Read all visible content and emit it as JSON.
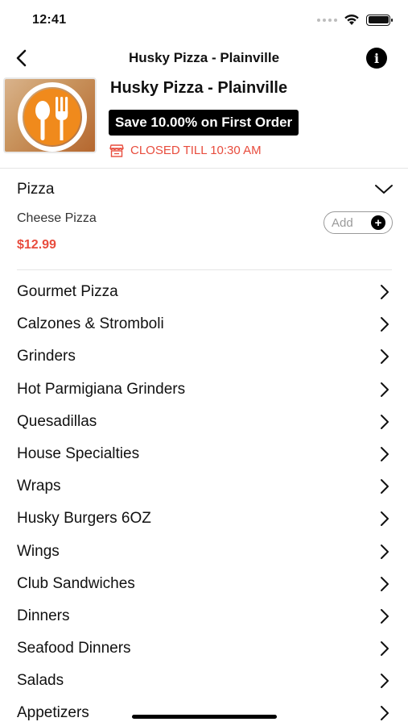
{
  "status_bar": {
    "time": "12:41"
  },
  "nav": {
    "title": "Husky Pizza - Plainville",
    "info_glyph": "i"
  },
  "restaurant": {
    "name": "Husky Pizza - Plainville",
    "promo": "Save 10.00% on First Order",
    "status": "CLOSED TILL 10:30 AM",
    "status_color": "#e84c3d"
  },
  "expanded_section": {
    "title": "Pizza",
    "items": [
      {
        "name": "Cheese Pizza",
        "price": "$12.99",
        "add_label": "Add",
        "add_glyph": "+"
      }
    ]
  },
  "categories": [
    "Gourmet Pizza",
    "Calzones & Stromboli",
    "Grinders",
    "Hot Parmigiana Grinders",
    "Quesadillas",
    "House Specialties",
    "Wraps",
    "Husky Burgers 6OZ",
    "Wings",
    "Club Sandwiches",
    "Dinners",
    "Seafood Dinners",
    "Salads",
    "Appetizers"
  ],
  "colors": {
    "accent": "#e84c3d",
    "logo_orange": "#f08a1c"
  }
}
